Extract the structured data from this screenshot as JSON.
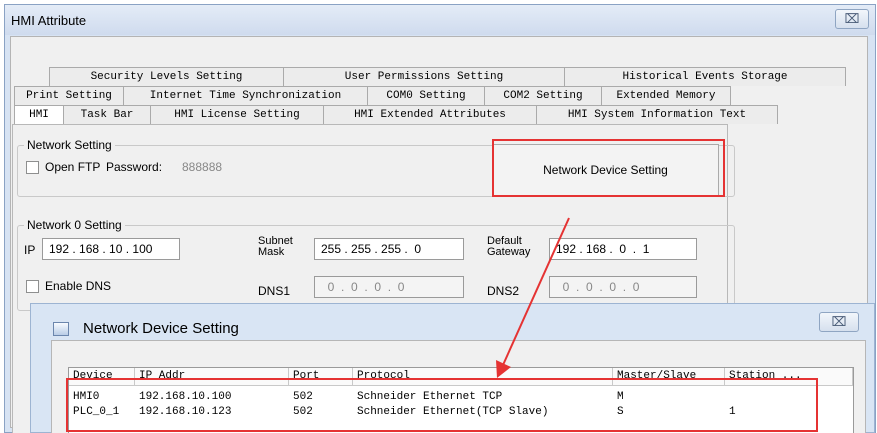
{
  "window": {
    "title": "HMI Attribute",
    "close_glyph": "⌧"
  },
  "tabs": {
    "row1": [
      "Security Levels Setting",
      "User Permissions Setting",
      "Historical Events Storage"
    ],
    "row2": [
      "Print Setting",
      "Internet Time Synchronization",
      "COM0 Setting",
      "COM2 Setting",
      "Extended Memory"
    ],
    "row3": [
      "HMI",
      "Task Bar",
      "HMI License Setting",
      "HMI Extended Attributes",
      "HMI System Information Text"
    ],
    "active": "HMI"
  },
  "network_setting": {
    "group_label": "Network Setting",
    "open_ftp_label": "Open FTP",
    "password_label": "Password:",
    "password_value": "888888",
    "device_button_label": "Network Device Setting"
  },
  "network0": {
    "group_label": "Network 0 Setting",
    "ip_label": "IP",
    "ip_value": "192 . 168 . 10 . 100",
    "subnet_label_1": "Subnet",
    "subnet_label_2": "Mask",
    "subnet_value": "255 . 255 . 255 .  0",
    "gateway_label_1": "Default",
    "gateway_label_2": "Gateway",
    "gateway_value": "192 . 168 .  0  .  1",
    "enable_dns_label": "Enable DNS",
    "dns1_label": "DNS1",
    "dns1_value": "  0  .  0  .  0  .  0",
    "dns2_label": "DNS2",
    "dns2_value": "  0  .  0  .  0  .  0"
  },
  "dialog": {
    "title": "Network Device Setting",
    "close_glyph": "⌧",
    "columns": [
      "Device",
      "IP Addr",
      "Port",
      "Protocol",
      "Master/Slave",
      "Station ..."
    ],
    "rows": [
      [
        "HMI0",
        "192.168.10.100",
        "502",
        "Schneider Ethernet TCP",
        "M",
        ""
      ],
      [
        "PLC_0_1",
        "192.168.10.123",
        "502",
        "Schneider Ethernet(TCP Slave)",
        "S",
        "1"
      ]
    ]
  },
  "colors": {
    "highlight": "#e53333",
    "dialog_bg": "#d9e5f4",
    "window_bg": "#d7e3f3"
  }
}
